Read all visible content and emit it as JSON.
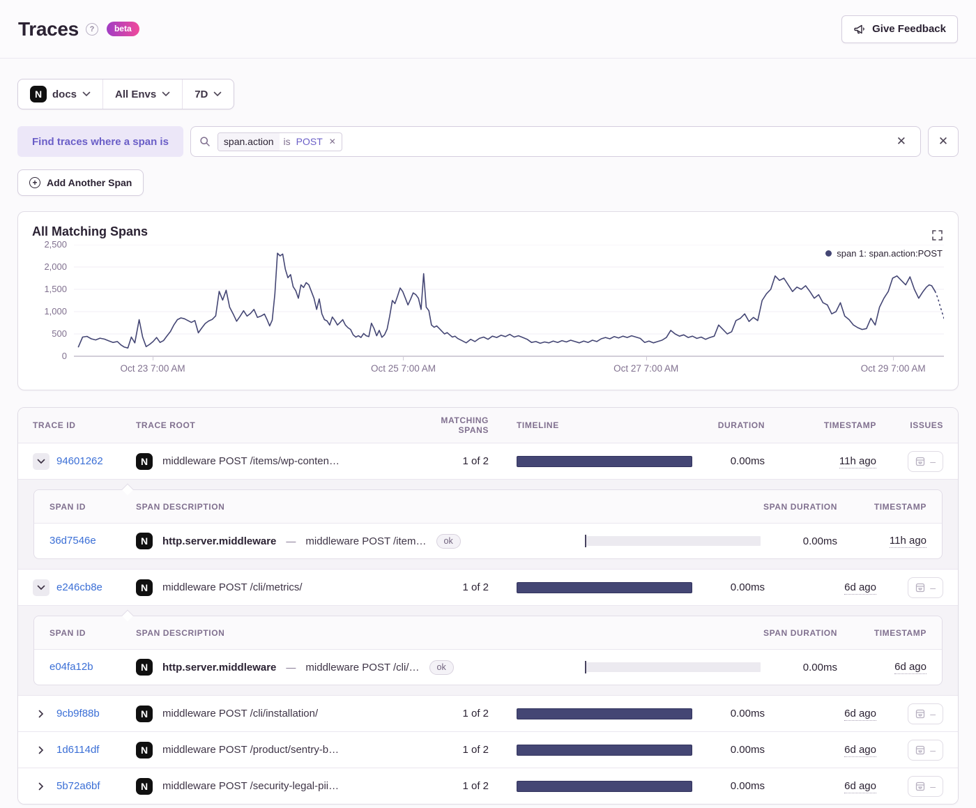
{
  "header": {
    "title": "Traces",
    "beta_label": "beta",
    "feedback_label": "Give Feedback"
  },
  "filters": {
    "project_icon_letter": "N",
    "project": "docs",
    "environment": "All Envs",
    "date_range": "7D"
  },
  "span_query": {
    "label": "Find traces where a span is",
    "token_key": "span.action",
    "token_op": "is",
    "token_value": "POST",
    "remove_token_glyph": "✕",
    "clear_glyph": "✕",
    "close_glyph": "✕",
    "add_button": "Add Another Span",
    "plus_glyph": "+"
  },
  "chart_data": {
    "type": "line",
    "title": "All Matching Spans",
    "legend": [
      {
        "label": "span 1: span.action:POST",
        "color": "#444674"
      }
    ],
    "grid": true,
    "legend_position": "top-right",
    "ylim": [
      0,
      2500
    ],
    "y_ticks": [
      {
        "label": "0",
        "value": 0
      },
      {
        "label": "500",
        "value": 500
      },
      {
        "label": "1,000",
        "value": 1000
      },
      {
        "label": "1,500",
        "value": 1500
      },
      {
        "label": "2,000",
        "value": 2000
      },
      {
        "label": "2,500",
        "value": 2500
      }
    ],
    "x_ticks": [
      {
        "label": "Oct 23 7:00 AM",
        "pos": 8.9
      },
      {
        "label": "Oct 25 7:00 AM",
        "pos": 37.7
      },
      {
        "label": "Oct 27 7:00 AM",
        "pos": 65.6
      },
      {
        "label": "Oct 29 7:00 AM",
        "pos": 94.0
      }
    ],
    "series": [
      {
        "name": "span 1: span.action:POST",
        "color": "#444674",
        "dashed_tail": 4,
        "points": [
          [
            0.5,
            200
          ],
          [
            1,
            430
          ],
          [
            1.5,
            445
          ],
          [
            2,
            390
          ],
          [
            2.5,
            365
          ],
          [
            3,
            405
          ],
          [
            3.5,
            385
          ],
          [
            4,
            345
          ],
          [
            4.5,
            310
          ],
          [
            5,
            330
          ],
          [
            5.4,
            255
          ],
          [
            5.8,
            205
          ],
          [
            6.2,
            185
          ],
          [
            6.6,
            430
          ],
          [
            7,
            300
          ],
          [
            7.5,
            820
          ],
          [
            7.9,
            430
          ],
          [
            8.3,
            215
          ],
          [
            8.7,
            265
          ],
          [
            9.1,
            330
          ],
          [
            9.5,
            420
          ],
          [
            9.9,
            310
          ],
          [
            10.3,
            350
          ],
          [
            10.7,
            455
          ],
          [
            11.1,
            555
          ],
          [
            11.5,
            705
          ],
          [
            11.9,
            820
          ],
          [
            12.3,
            860
          ],
          [
            12.7,
            840
          ],
          [
            13.1,
            800
          ],
          [
            13.5,
            760
          ],
          [
            13.9,
            800
          ],
          [
            14.3,
            525
          ],
          [
            14.7,
            635
          ],
          [
            15.1,
            735
          ],
          [
            15.5,
            790
          ],
          [
            15.9,
            825
          ],
          [
            16.3,
            905
          ],
          [
            16.7,
            1455
          ],
          [
            17.1,
            1260
          ],
          [
            17.5,
            1480
          ],
          [
            17.9,
            1100
          ],
          [
            18.3,
            950
          ],
          [
            18.7,
            785
          ],
          [
            19.1,
            895
          ],
          [
            19.5,
            1020
          ],
          [
            19.9,
            900
          ],
          [
            20.3,
            960
          ],
          [
            20.7,
            1050
          ],
          [
            21.1,
            870
          ],
          [
            21.5,
            900
          ],
          [
            21.9,
            945
          ],
          [
            22.2,
            820
          ],
          [
            22.5,
            680
          ],
          [
            22.8,
            810
          ],
          [
            23.1,
            1400
          ],
          [
            23.4,
            2310
          ],
          [
            23.7,
            2250
          ],
          [
            24,
            2290
          ],
          [
            24.3,
            1950
          ],
          [
            24.6,
            1760
          ],
          [
            24.9,
            1830
          ],
          [
            25.2,
            1560
          ],
          [
            25.5,
            1470
          ],
          [
            25.8,
            1300
          ],
          [
            26.1,
            1600
          ],
          [
            26.4,
            1540
          ],
          [
            26.7,
            1650
          ],
          [
            27,
            1600
          ],
          [
            27.3,
            1450
          ],
          [
            27.6,
            1300
          ],
          [
            27.9,
            1050
          ],
          [
            28.2,
            1285
          ],
          [
            28.5,
            950
          ],
          [
            28.8,
            820
          ],
          [
            29.1,
            790
          ],
          [
            29.4,
            700
          ],
          [
            29.7,
            880
          ],
          [
            30,
            800
          ],
          [
            30.3,
            700
          ],
          [
            30.6,
            760
          ],
          [
            30.9,
            820
          ],
          [
            31.2,
            700
          ],
          [
            31.5,
            640
          ],
          [
            31.8,
            600
          ],
          [
            32.1,
            480
          ],
          [
            32.4,
            430
          ],
          [
            32.7,
            460
          ],
          [
            33,
            420
          ],
          [
            33.3,
            510
          ],
          [
            33.6,
            460
          ],
          [
            33.9,
            440
          ],
          [
            34.2,
            740
          ],
          [
            34.5,
            620
          ],
          [
            34.8,
            460
          ],
          [
            35.1,
            580
          ],
          [
            35.4,
            425
          ],
          [
            35.7,
            480
          ],
          [
            36,
            610
          ],
          [
            36.3,
            900
          ],
          [
            36.6,
            1250
          ],
          [
            36.9,
            1180
          ],
          [
            37.2,
            1350
          ],
          [
            37.5,
            1530
          ],
          [
            37.8,
            1450
          ],
          [
            38.1,
            1300
          ],
          [
            38.4,
            1150
          ],
          [
            38.7,
            1280
          ],
          [
            39,
            1420
          ],
          [
            39.3,
            1380
          ],
          [
            39.6,
            1300
          ],
          [
            39.9,
            1050
          ],
          [
            40.2,
            1850
          ],
          [
            40.5,
            1100
          ],
          [
            40.8,
            1020
          ],
          [
            41.1,
            700
          ],
          [
            41.4,
            650
          ],
          [
            41.7,
            680
          ],
          [
            42,
            620
          ],
          [
            42.3,
            560
          ],
          [
            42.6,
            500
          ],
          [
            42.9,
            530
          ],
          [
            43.2,
            480
          ],
          [
            43.5,
            430
          ],
          [
            43.8,
            450
          ],
          [
            44.1,
            400
          ],
          [
            44.6,
            350
          ],
          [
            45.1,
            300
          ],
          [
            45.6,
            380
          ],
          [
            46.1,
            330
          ],
          [
            46.6,
            400
          ],
          [
            47.1,
            430
          ],
          [
            47.6,
            380
          ],
          [
            48.1,
            450
          ],
          [
            48.6,
            420
          ],
          [
            49.1,
            470
          ],
          [
            49.6,
            440
          ],
          [
            50.1,
            490
          ],
          [
            50.6,
            430
          ],
          [
            51.1,
            460
          ],
          [
            51.6,
            420
          ],
          [
            52.1,
            380
          ],
          [
            52.6,
            310
          ],
          [
            53.1,
            330
          ],
          [
            53.6,
            290
          ],
          [
            54.1,
            320
          ],
          [
            54.6,
            300
          ],
          [
            55.1,
            340
          ],
          [
            55.6,
            310
          ],
          [
            56.1,
            350
          ],
          [
            56.6,
            320
          ],
          [
            57.1,
            360
          ],
          [
            57.6,
            330
          ],
          [
            58.1,
            300
          ],
          [
            58.6,
            340
          ],
          [
            59.1,
            310
          ],
          [
            59.6,
            360
          ],
          [
            60.1,
            330
          ],
          [
            60.6,
            390
          ],
          [
            61.1,
            420
          ],
          [
            61.6,
            390
          ],
          [
            62.1,
            440
          ],
          [
            62.6,
            410
          ],
          [
            63.1,
            450
          ],
          [
            63.6,
            420
          ],
          [
            64.1,
            460
          ],
          [
            64.6,
            430
          ],
          [
            65.1,
            400
          ],
          [
            65.6,
            310
          ],
          [
            66.1,
            340
          ],
          [
            66.6,
            300
          ],
          [
            67.1,
            330
          ],
          [
            67.6,
            360
          ],
          [
            68.1,
            420
          ],
          [
            68.6,
            580
          ],
          [
            69.1,
            500
          ],
          [
            69.6,
            450
          ],
          [
            70.1,
            480
          ],
          [
            70.6,
            420
          ],
          [
            71.1,
            450
          ],
          [
            71.6,
            400
          ],
          [
            72.1,
            430
          ],
          [
            72.6,
            380
          ],
          [
            73.1,
            420
          ],
          [
            73.6,
            450
          ],
          [
            74.1,
            700
          ],
          [
            74.6,
            600
          ],
          [
            75.1,
            500
          ],
          [
            75.6,
            550
          ],
          [
            76.1,
            800
          ],
          [
            76.6,
            850
          ],
          [
            77.1,
            950
          ],
          [
            77.6,
            780
          ],
          [
            78.1,
            870
          ],
          [
            78.6,
            800
          ],
          [
            79.1,
            1250
          ],
          [
            79.6,
            1400
          ],
          [
            80.1,
            1500
          ],
          [
            80.6,
            1800
          ],
          [
            81.1,
            1700
          ],
          [
            81.6,
            1750
          ],
          [
            82.1,
            1600
          ],
          [
            82.6,
            1450
          ],
          [
            83.1,
            1550
          ],
          [
            83.6,
            1500
          ],
          [
            84.1,
            1580
          ],
          [
            84.6,
            1450
          ],
          [
            85.1,
            1300
          ],
          [
            85.6,
            1380
          ],
          [
            86.1,
            1200
          ],
          [
            86.6,
            1150
          ],
          [
            87.1,
            950
          ],
          [
            87.6,
            1000
          ],
          [
            88.1,
            1200
          ],
          [
            88.6,
            900
          ],
          [
            89.1,
            820
          ],
          [
            89.6,
            700
          ],
          [
            90.1,
            640
          ],
          [
            90.6,
            600
          ],
          [
            91.1,
            620
          ],
          [
            91.6,
            850
          ],
          [
            92.1,
            700
          ],
          [
            92.6,
            1100
          ],
          [
            93.1,
            1300
          ],
          [
            93.6,
            1450
          ],
          [
            94.1,
            1750
          ],
          [
            94.6,
            1800
          ],
          [
            95.1,
            1700
          ],
          [
            95.6,
            1600
          ],
          [
            96.1,
            1780
          ],
          [
            96.6,
            1500
          ],
          [
            97.1,
            1300
          ],
          [
            97.6,
            1450
          ],
          [
            98,
            1550
          ],
          [
            98.3,
            1600
          ],
          [
            98.6,
            1580
          ],
          [
            99,
            1450
          ],
          [
            99.3,
            1300
          ],
          [
            99.6,
            1100
          ],
          [
            100,
            850
          ]
        ]
      }
    ]
  },
  "table": {
    "headers": [
      "TRACE ID",
      "TRACE ROOT",
      "MATCHING SPANS",
      "TIMELINE",
      "DURATION",
      "TIMESTAMP",
      "ISSUES"
    ],
    "sub_headers": [
      "SPAN ID",
      "SPAN DESCRIPTION",
      "SPAN DURATION",
      "TIMESTAMP"
    ],
    "issues_none": "–",
    "project_icon_letter": "N",
    "rows": [
      {
        "trace_id": "94601262",
        "trace_root": "middleware POST /items/wp-conten…",
        "matching_spans": "1 of 2",
        "duration": "0.00ms",
        "timestamp": "11h ago",
        "expanded": true,
        "spans": [
          {
            "span_id": "36d7546e",
            "op": "http.server.middleware",
            "separator": "—",
            "description": "middleware POST /item…",
            "status": "ok",
            "duration": "0.00ms",
            "timestamp": "11h ago"
          }
        ]
      },
      {
        "trace_id": "e246cb8e",
        "trace_root": "middleware POST /cli/metrics/",
        "matching_spans": "1 of 2",
        "duration": "0.00ms",
        "timestamp": "6d ago",
        "expanded": true,
        "spans": [
          {
            "span_id": "e04fa12b",
            "op": "http.server.middleware",
            "separator": "—",
            "description": "middleware POST /cli/…",
            "status": "ok",
            "duration": "0.00ms",
            "timestamp": "6d ago"
          }
        ]
      },
      {
        "trace_id": "9cb9f88b",
        "trace_root": "middleware POST /cli/installation/",
        "matching_spans": "1 of 2",
        "duration": "0.00ms",
        "timestamp": "6d ago",
        "expanded": false
      },
      {
        "trace_id": "1d6114df",
        "trace_root": "middleware POST /product/sentry-b…",
        "matching_spans": "1 of 2",
        "duration": "0.00ms",
        "timestamp": "6d ago",
        "expanded": false
      },
      {
        "trace_id": "5b72a6bf",
        "trace_root": "middleware POST /security-legal-pii…",
        "matching_spans": "1 of 2",
        "duration": "0.00ms",
        "timestamp": "6d ago",
        "expanded": false
      }
    ]
  }
}
